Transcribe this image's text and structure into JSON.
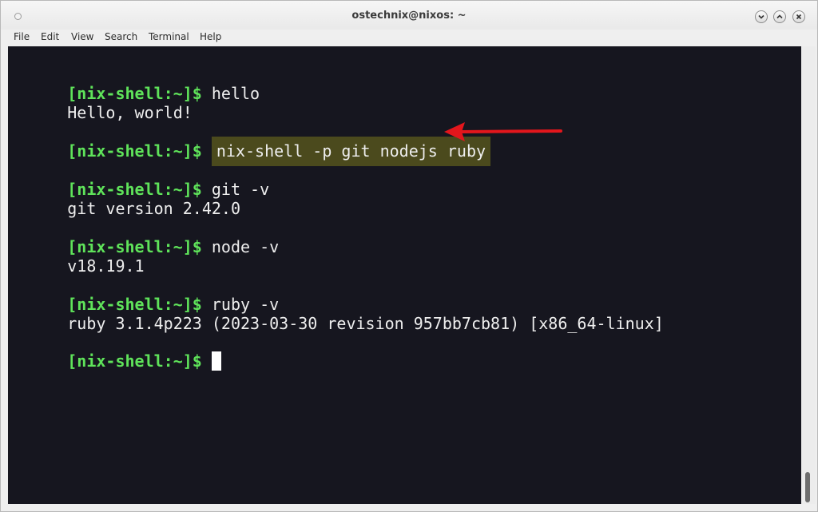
{
  "window": {
    "title": "ostechnix@nixos: ~"
  },
  "menu": {
    "items": [
      "File",
      "Edit",
      "View",
      "Search",
      "Terminal",
      "Help"
    ]
  },
  "terminal": {
    "prompt": "[nix-shell:~]$",
    "lines": [
      {
        "type": "cmd",
        "text": "hello"
      },
      {
        "type": "out",
        "text": "Hello, world!"
      },
      {
        "type": "cmd",
        "text": "nix-shell -p git nodejs ruby",
        "highlight": true
      },
      {
        "type": "cmd",
        "text": "git -v"
      },
      {
        "type": "out",
        "text": "git version 2.42.0"
      },
      {
        "type": "cmd",
        "text": "node -v"
      },
      {
        "type": "out",
        "text": "v18.19.1"
      },
      {
        "type": "cmd",
        "text": "ruby -v"
      },
      {
        "type": "out",
        "text": "ruby 3.1.4p223 (2023-03-30 revision 957bb7cb81) [x86_64-linux]"
      },
      {
        "type": "cmd",
        "text": ""
      }
    ]
  },
  "colors": {
    "terminal_bg": "#16161f",
    "prompt": "#5fe35a",
    "output": "#eeeeee",
    "highlight": "#4b4a1d",
    "annotation_arrow": "#e3161c"
  },
  "icons": {
    "window_menu": "circle-icon",
    "minimize": "chevron-down-icon",
    "maximize": "chevron-up-icon",
    "close": "close-icon",
    "annotation": "arrow-left-icon"
  }
}
